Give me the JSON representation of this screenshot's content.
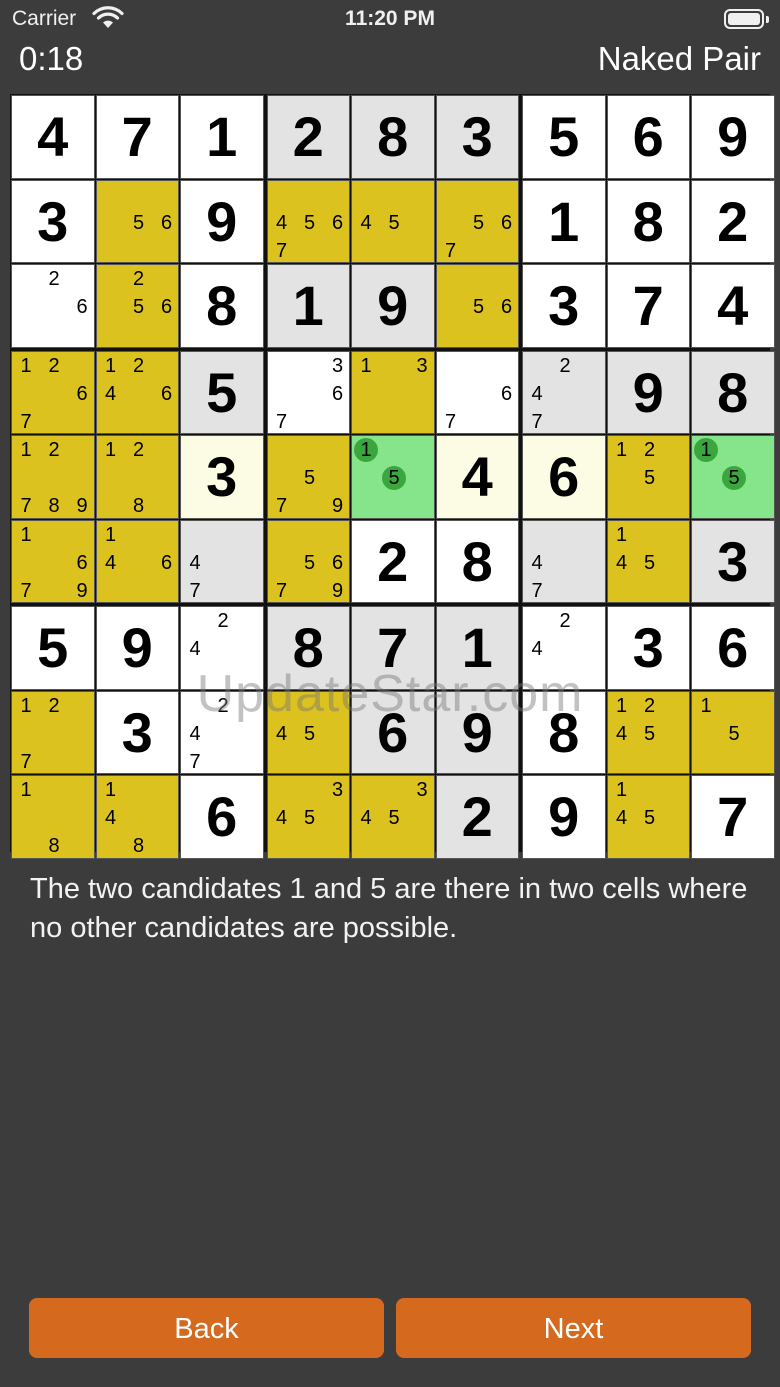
{
  "status_bar": {
    "carrier": "Carrier",
    "time": "11:20 PM"
  },
  "header": {
    "timer": "0:18",
    "technique": "Naked Pair"
  },
  "board": {
    "cells": [
      [
        {
          "v": "4",
          "bg": "white"
        },
        {
          "v": "7",
          "bg": "white"
        },
        {
          "v": "1",
          "bg": "white"
        },
        {
          "v": "2",
          "bg": "gray"
        },
        {
          "v": "8",
          "bg": "gray"
        },
        {
          "v": "3",
          "bg": "gray"
        },
        {
          "v": "5",
          "bg": "white"
        },
        {
          "v": "6",
          "bg": "white"
        },
        {
          "v": "9",
          "bg": "white"
        }
      ],
      [
        {
          "v": "3",
          "bg": "white"
        },
        {
          "c": [
            5,
            6
          ],
          "bg": "yellow"
        },
        {
          "v": "9",
          "bg": "white"
        },
        {
          "c": [
            4,
            5,
            6,
            7
          ],
          "bg": "yellow"
        },
        {
          "c": [
            4,
            5
          ],
          "bg": "yellow"
        },
        {
          "c": [
            5,
            6,
            7
          ],
          "bg": "yellow"
        },
        {
          "v": "1",
          "bg": "white"
        },
        {
          "v": "8",
          "bg": "white"
        },
        {
          "v": "2",
          "bg": "white"
        }
      ],
      [
        {
          "c": [
            2,
            6
          ],
          "bg": "white"
        },
        {
          "c": [
            2,
            5,
            6
          ],
          "bg": "yellow"
        },
        {
          "v": "8",
          "bg": "white"
        },
        {
          "v": "1",
          "bg": "gray"
        },
        {
          "v": "9",
          "bg": "gray"
        },
        {
          "c": [
            5,
            6
          ],
          "bg": "yellow"
        },
        {
          "v": "3",
          "bg": "white"
        },
        {
          "v": "7",
          "bg": "white"
        },
        {
          "v": "4",
          "bg": "white"
        }
      ],
      [
        {
          "c": [
            1,
            2,
            6,
            7
          ],
          "bg": "yellow"
        },
        {
          "c": [
            1,
            2,
            4,
            6
          ],
          "bg": "yellow"
        },
        {
          "v": "5",
          "bg": "gray"
        },
        {
          "c": [
            3,
            6,
            7
          ],
          "bg": "white"
        },
        {
          "c": [
            1,
            3
          ],
          "bg": "yellow"
        },
        {
          "c": [
            6,
            7
          ],
          "bg": "white"
        },
        {
          "c": [
            2,
            4,
            7
          ],
          "bg": "gray"
        },
        {
          "v": "9",
          "bg": "gray"
        },
        {
          "v": "8",
          "bg": "gray"
        }
      ],
      [
        {
          "c": [
            1,
            2,
            7,
            8,
            9
          ],
          "bg": "yellow"
        },
        {
          "c": [
            1,
            2,
            8
          ],
          "bg": "yellow"
        },
        {
          "v": "3",
          "bg": "cream"
        },
        {
          "c": [
            5,
            7,
            9
          ],
          "bg": "yellow"
        },
        {
          "c": [
            1,
            5
          ],
          "bg": "green",
          "hl": [
            1,
            5
          ]
        },
        {
          "v": "4",
          "bg": "cream"
        },
        {
          "v": "6",
          "bg": "cream"
        },
        {
          "c": [
            1,
            2,
            5
          ],
          "bg": "yellow"
        },
        {
          "c": [
            1,
            5
          ],
          "bg": "green",
          "hl": [
            1,
            5
          ]
        }
      ],
      [
        {
          "c": [
            1,
            6,
            7,
            9
          ],
          "bg": "yellow"
        },
        {
          "c": [
            1,
            4,
            6
          ],
          "bg": "yellow"
        },
        {
          "c": [
            4,
            7
          ],
          "bg": "gray"
        },
        {
          "c": [
            5,
            6,
            7,
            9
          ],
          "bg": "yellow"
        },
        {
          "v": "2",
          "bg": "white"
        },
        {
          "v": "8",
          "bg": "white"
        },
        {
          "c": [
            4,
            7
          ],
          "bg": "gray"
        },
        {
          "c": [
            1,
            4,
            5
          ],
          "bg": "yellow"
        },
        {
          "v": "3",
          "bg": "gray"
        }
      ],
      [
        {
          "v": "5",
          "bg": "white"
        },
        {
          "v": "9",
          "bg": "white"
        },
        {
          "c": [
            2,
            4
          ],
          "bg": "white"
        },
        {
          "v": "8",
          "bg": "gray"
        },
        {
          "v": "7",
          "bg": "gray"
        },
        {
          "v": "1",
          "bg": "gray"
        },
        {
          "c": [
            2,
            4
          ],
          "bg": "white"
        },
        {
          "v": "3",
          "bg": "white"
        },
        {
          "v": "6",
          "bg": "white"
        }
      ],
      [
        {
          "c": [
            1,
            2,
            7
          ],
          "bg": "yellow"
        },
        {
          "v": "3",
          "bg": "white"
        },
        {
          "c": [
            2,
            4,
            7
          ],
          "bg": "white"
        },
        {
          "c": [
            4,
            5
          ],
          "bg": "yellow"
        },
        {
          "v": "6",
          "bg": "gray"
        },
        {
          "v": "9",
          "bg": "gray"
        },
        {
          "v": "8",
          "bg": "white"
        },
        {
          "c": [
            1,
            2,
            4,
            5
          ],
          "bg": "yellow"
        },
        {
          "c": [
            1,
            5
          ],
          "bg": "yellow"
        }
      ],
      [
        {
          "c": [
            1,
            8
          ],
          "bg": "yellow"
        },
        {
          "c": [
            1,
            4,
            8
          ],
          "bg": "yellow"
        },
        {
          "v": "6",
          "bg": "white"
        },
        {
          "c": [
            3,
            4,
            5
          ],
          "bg": "yellow"
        },
        {
          "c": [
            3,
            4,
            5
          ],
          "bg": "yellow"
        },
        {
          "v": "2",
          "bg": "gray"
        },
        {
          "v": "9",
          "bg": "white"
        },
        {
          "c": [
            1,
            4,
            5
          ],
          "bg": "yellow"
        },
        {
          "v": "7",
          "bg": "white"
        }
      ]
    ]
  },
  "watermark": "UpdateStar.com",
  "explanation": "The two candidates 1 and 5 are there in two cells where no other candidates are possible.",
  "buttons": {
    "back": "Back",
    "next": "Next"
  }
}
